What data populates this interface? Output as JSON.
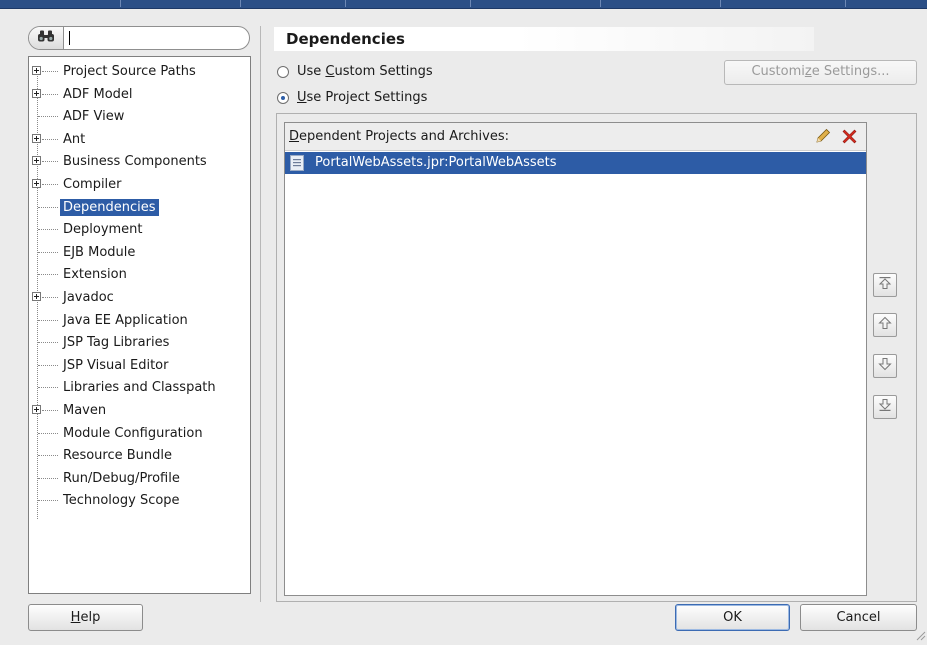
{
  "search": {
    "value": "",
    "placeholder": ""
  },
  "tree": {
    "items": [
      {
        "label": "Project Source Paths",
        "expandable": true
      },
      {
        "label": "ADF Model",
        "expandable": true
      },
      {
        "label": "ADF View",
        "expandable": false
      },
      {
        "label": "Ant",
        "expandable": true
      },
      {
        "label": "Business Components",
        "expandable": true
      },
      {
        "label": "Compiler",
        "expandable": true
      },
      {
        "label": "Dependencies",
        "expandable": false,
        "selected": true
      },
      {
        "label": "Deployment",
        "expandable": false
      },
      {
        "label": "EJB Module",
        "expandable": false
      },
      {
        "label": "Extension",
        "expandable": false
      },
      {
        "label": "Javadoc",
        "expandable": true
      },
      {
        "label": "Java EE Application",
        "expandable": false
      },
      {
        "label": "JSP Tag Libraries",
        "expandable": false
      },
      {
        "label": "JSP Visual Editor",
        "expandable": false
      },
      {
        "label": "Libraries and Classpath",
        "expandable": false
      },
      {
        "label": "Maven",
        "expandable": true
      },
      {
        "label": "Module Configuration",
        "expandable": false
      },
      {
        "label": "Resource Bundle",
        "expandable": false
      },
      {
        "label": "Run/Debug/Profile",
        "expandable": false
      },
      {
        "label": "Technology Scope",
        "expandable": false
      }
    ]
  },
  "panel": {
    "title": "Dependencies",
    "radio_custom": {
      "pre": "Use ",
      "mnemonic": "C",
      "post": "ustom Settings",
      "checked": false
    },
    "radio_project": {
      "pre": "",
      "mnemonic": "U",
      "post": "se Project Settings",
      "checked": true
    },
    "customize_button": {
      "pre": "Customi",
      "mnemonic": "z",
      "post": "e Settings...",
      "enabled": false
    },
    "list": {
      "title_mnemonic": "D",
      "title_rest": "ependent Projects and Archives:",
      "items": [
        {
          "label": "PortalWebAssets.jpr:PortalWebAssets",
          "selected": true
        }
      ]
    }
  },
  "side_buttons": [
    "move-to-top",
    "move-up",
    "move-down",
    "move-to-bottom"
  ],
  "footer": {
    "help": {
      "mnemonic": "H",
      "rest": "elp"
    },
    "ok": "OK",
    "cancel": "Cancel"
  },
  "colors": {
    "selection": "#2d5ca6",
    "title_bar": "#2b4f86",
    "delete_icon": "#d62b1f",
    "edit_icon": "#c79a2a"
  }
}
